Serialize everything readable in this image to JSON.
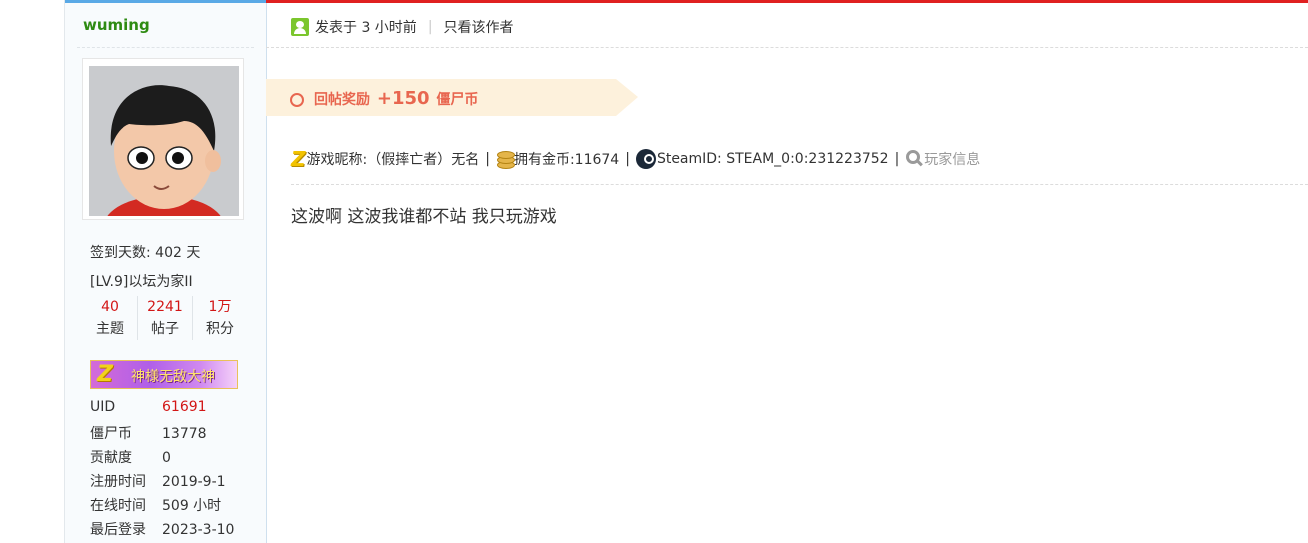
{
  "author": {
    "username": "wuming",
    "signin_days": "签到天数: 402 天",
    "level": "[LV.9]以坛为家II",
    "stats": [
      {
        "value": "40",
        "label": "主题"
      },
      {
        "value": "2241",
        "label": "帖子"
      },
      {
        "value": "1万",
        "label": "积分"
      }
    ],
    "medal": "神様无敌大神",
    "profile": [
      {
        "key": "UID",
        "value": "61691",
        "highlight": true
      },
      {
        "key": "僵尸币",
        "value": "13778"
      },
      {
        "key": "贡献度",
        "value": "0"
      },
      {
        "key": "注册时间",
        "value": "2019-9-1"
      },
      {
        "key": "在线时间",
        "value": "509 小时"
      },
      {
        "key": "最后登录",
        "value": "2023-3-10"
      }
    ]
  },
  "post": {
    "posted_at": "发表于 3 小时前",
    "only_author": "只看该作者",
    "reward": {
      "prefix": "回帖奖励",
      "amount": "+150",
      "unit": "僵尸币"
    },
    "game_nickname": "游戏昵称:（假摔亡者）无名",
    "gold": "拥有金币:11674",
    "steam_id": "SteamID: STEAM_0:0:231223752",
    "player_info": "玩家信息",
    "separator": "|",
    "content": "这波啊 这波我谁都不站 我只玩游戏"
  },
  "colors": {
    "username": "#2e8b12",
    "accent_red": "#d21616",
    "reward": "#e8664f",
    "reward_bg": "#fdf1dc",
    "sidebar_top": "#5aa9e6",
    "main_top": "#e02020"
  },
  "icons": {
    "meta": "user-icon",
    "game": "z-logo-icon",
    "gold": "coin-stack-icon",
    "steam": "steam-icon",
    "player": "magnifier-icon"
  }
}
